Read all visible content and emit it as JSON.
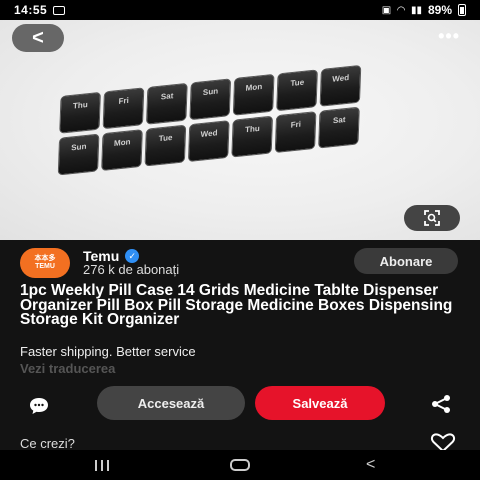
{
  "status": {
    "time": "14:55",
    "battery": "89%"
  },
  "viewer": {
    "back_glyph": "<",
    "more_glyph": "•••"
  },
  "pill_case": {
    "top_row": [
      "Thu",
      "Fri",
      "Sat",
      "Sun",
      "Mon",
      "Tue",
      "Wed"
    ],
    "bottom_row": [
      "Sun",
      "Mon",
      "Tue",
      "Wed",
      "Thu",
      "Fri",
      "Sat"
    ]
  },
  "channel": {
    "logo_line1": "本本多",
    "logo_line2": "TEMU",
    "name": "Temu",
    "subscribers": "276 k de abonați",
    "subscribe_label": "Abonare"
  },
  "pin": {
    "title": "1pc Weekly Pill Case 14 Grids Medicine Tablte Dispenser Organizer Pill Box Pill Storage Medicine Boxes Dispensing Storage Kit Organizer",
    "tagline": "Faster shipping. Better service",
    "translate_link": "Vezi traducerea"
  },
  "actions": {
    "visit_label": "Accesează",
    "save_label": "Salvează"
  },
  "comments": {
    "prompt": "Ce crezi?"
  },
  "colors": {
    "save_red": "#e6132a",
    "temu_orange": "#f37021",
    "verified_blue": "#2f8ff5"
  },
  "icons": [
    "back-icon",
    "more-icon",
    "visual-search-icon",
    "verified-icon",
    "comment-icon",
    "share-icon",
    "heart-icon"
  ]
}
